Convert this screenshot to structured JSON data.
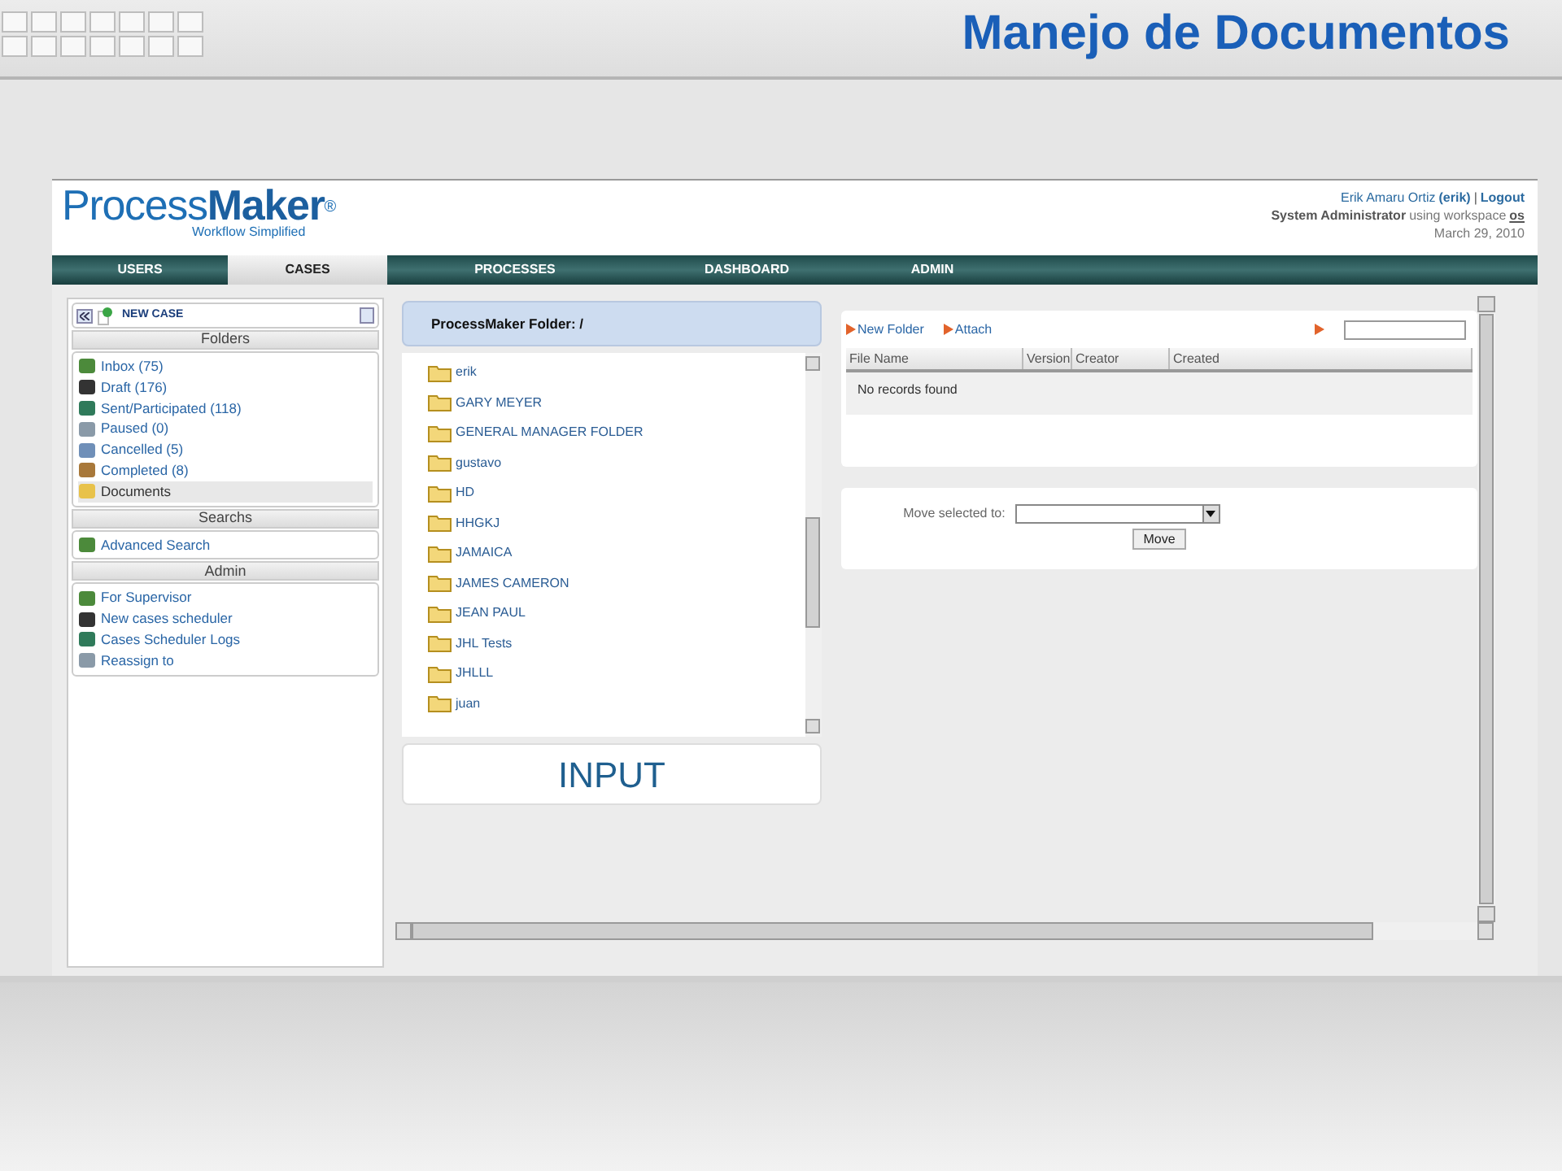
{
  "slide_title": "Manejo de Documentos",
  "app": {
    "logo": {
      "light": "Process",
      "bold": "Maker",
      "mark": "®",
      "tagline": "Workflow Simplified"
    },
    "user": {
      "name": "Erik Amaru Ortiz",
      "username": "(erik)",
      "separator": "|",
      "logout": "Logout",
      "role": "System Administrator",
      "workspace_text": "using workspace",
      "workspace": "os",
      "date": "March 29, 2010"
    },
    "nav": [
      {
        "label": "USERS",
        "selected": false
      },
      {
        "label": "CASES",
        "selected": true
      },
      {
        "label": "PROCESSES",
        "selected": false
      },
      {
        "label": "DASHBOARD",
        "selected": false
      },
      {
        "label": "ADMIN",
        "selected": false
      }
    ]
  },
  "sidebar": {
    "new_case": "NEW CASE",
    "sections": [
      {
        "title": "Folders",
        "items": [
          {
            "label": "Inbox (75)",
            "selected": false
          },
          {
            "label": "Draft (176)",
            "selected": false
          },
          {
            "label": "Sent/Participated (118)",
            "selected": false
          },
          {
            "label": "Paused (0)",
            "selected": false
          },
          {
            "label": "Cancelled (5)",
            "selected": false
          },
          {
            "label": "Completed (8)",
            "selected": false
          },
          {
            "label": "Documents",
            "selected": true
          }
        ]
      },
      {
        "title": "Searchs",
        "items": [
          {
            "label": "Advanced Search",
            "selected": false
          }
        ]
      },
      {
        "title": "Admin",
        "items": [
          {
            "label": "For Supervisor",
            "selected": false
          },
          {
            "label": "New cases scheduler",
            "selected": false
          },
          {
            "label": "Cases Scheduler Logs",
            "selected": false
          },
          {
            "label": "Reassign to",
            "selected": false
          }
        ]
      }
    ]
  },
  "folder_panel": {
    "title": "ProcessMaker Folder: /",
    "folders": [
      "erik",
      "GARY MEYER",
      "GENERAL MANAGER FOLDER",
      "gustavo",
      "HD",
      "HHGKJ",
      "JAMAICA",
      "JAMES CAMERON",
      "JEAN PAUL",
      "JHL Tests",
      "JHLLL",
      "juan"
    ]
  },
  "input_label": "INPUT",
  "files": {
    "toolbar": [
      "New Folder",
      "Attach"
    ],
    "columns": [
      "File Name",
      "Version",
      "Creator",
      "Created"
    ],
    "empty": "No records found"
  },
  "move": {
    "label": "Move selected to:",
    "button": "Move"
  }
}
